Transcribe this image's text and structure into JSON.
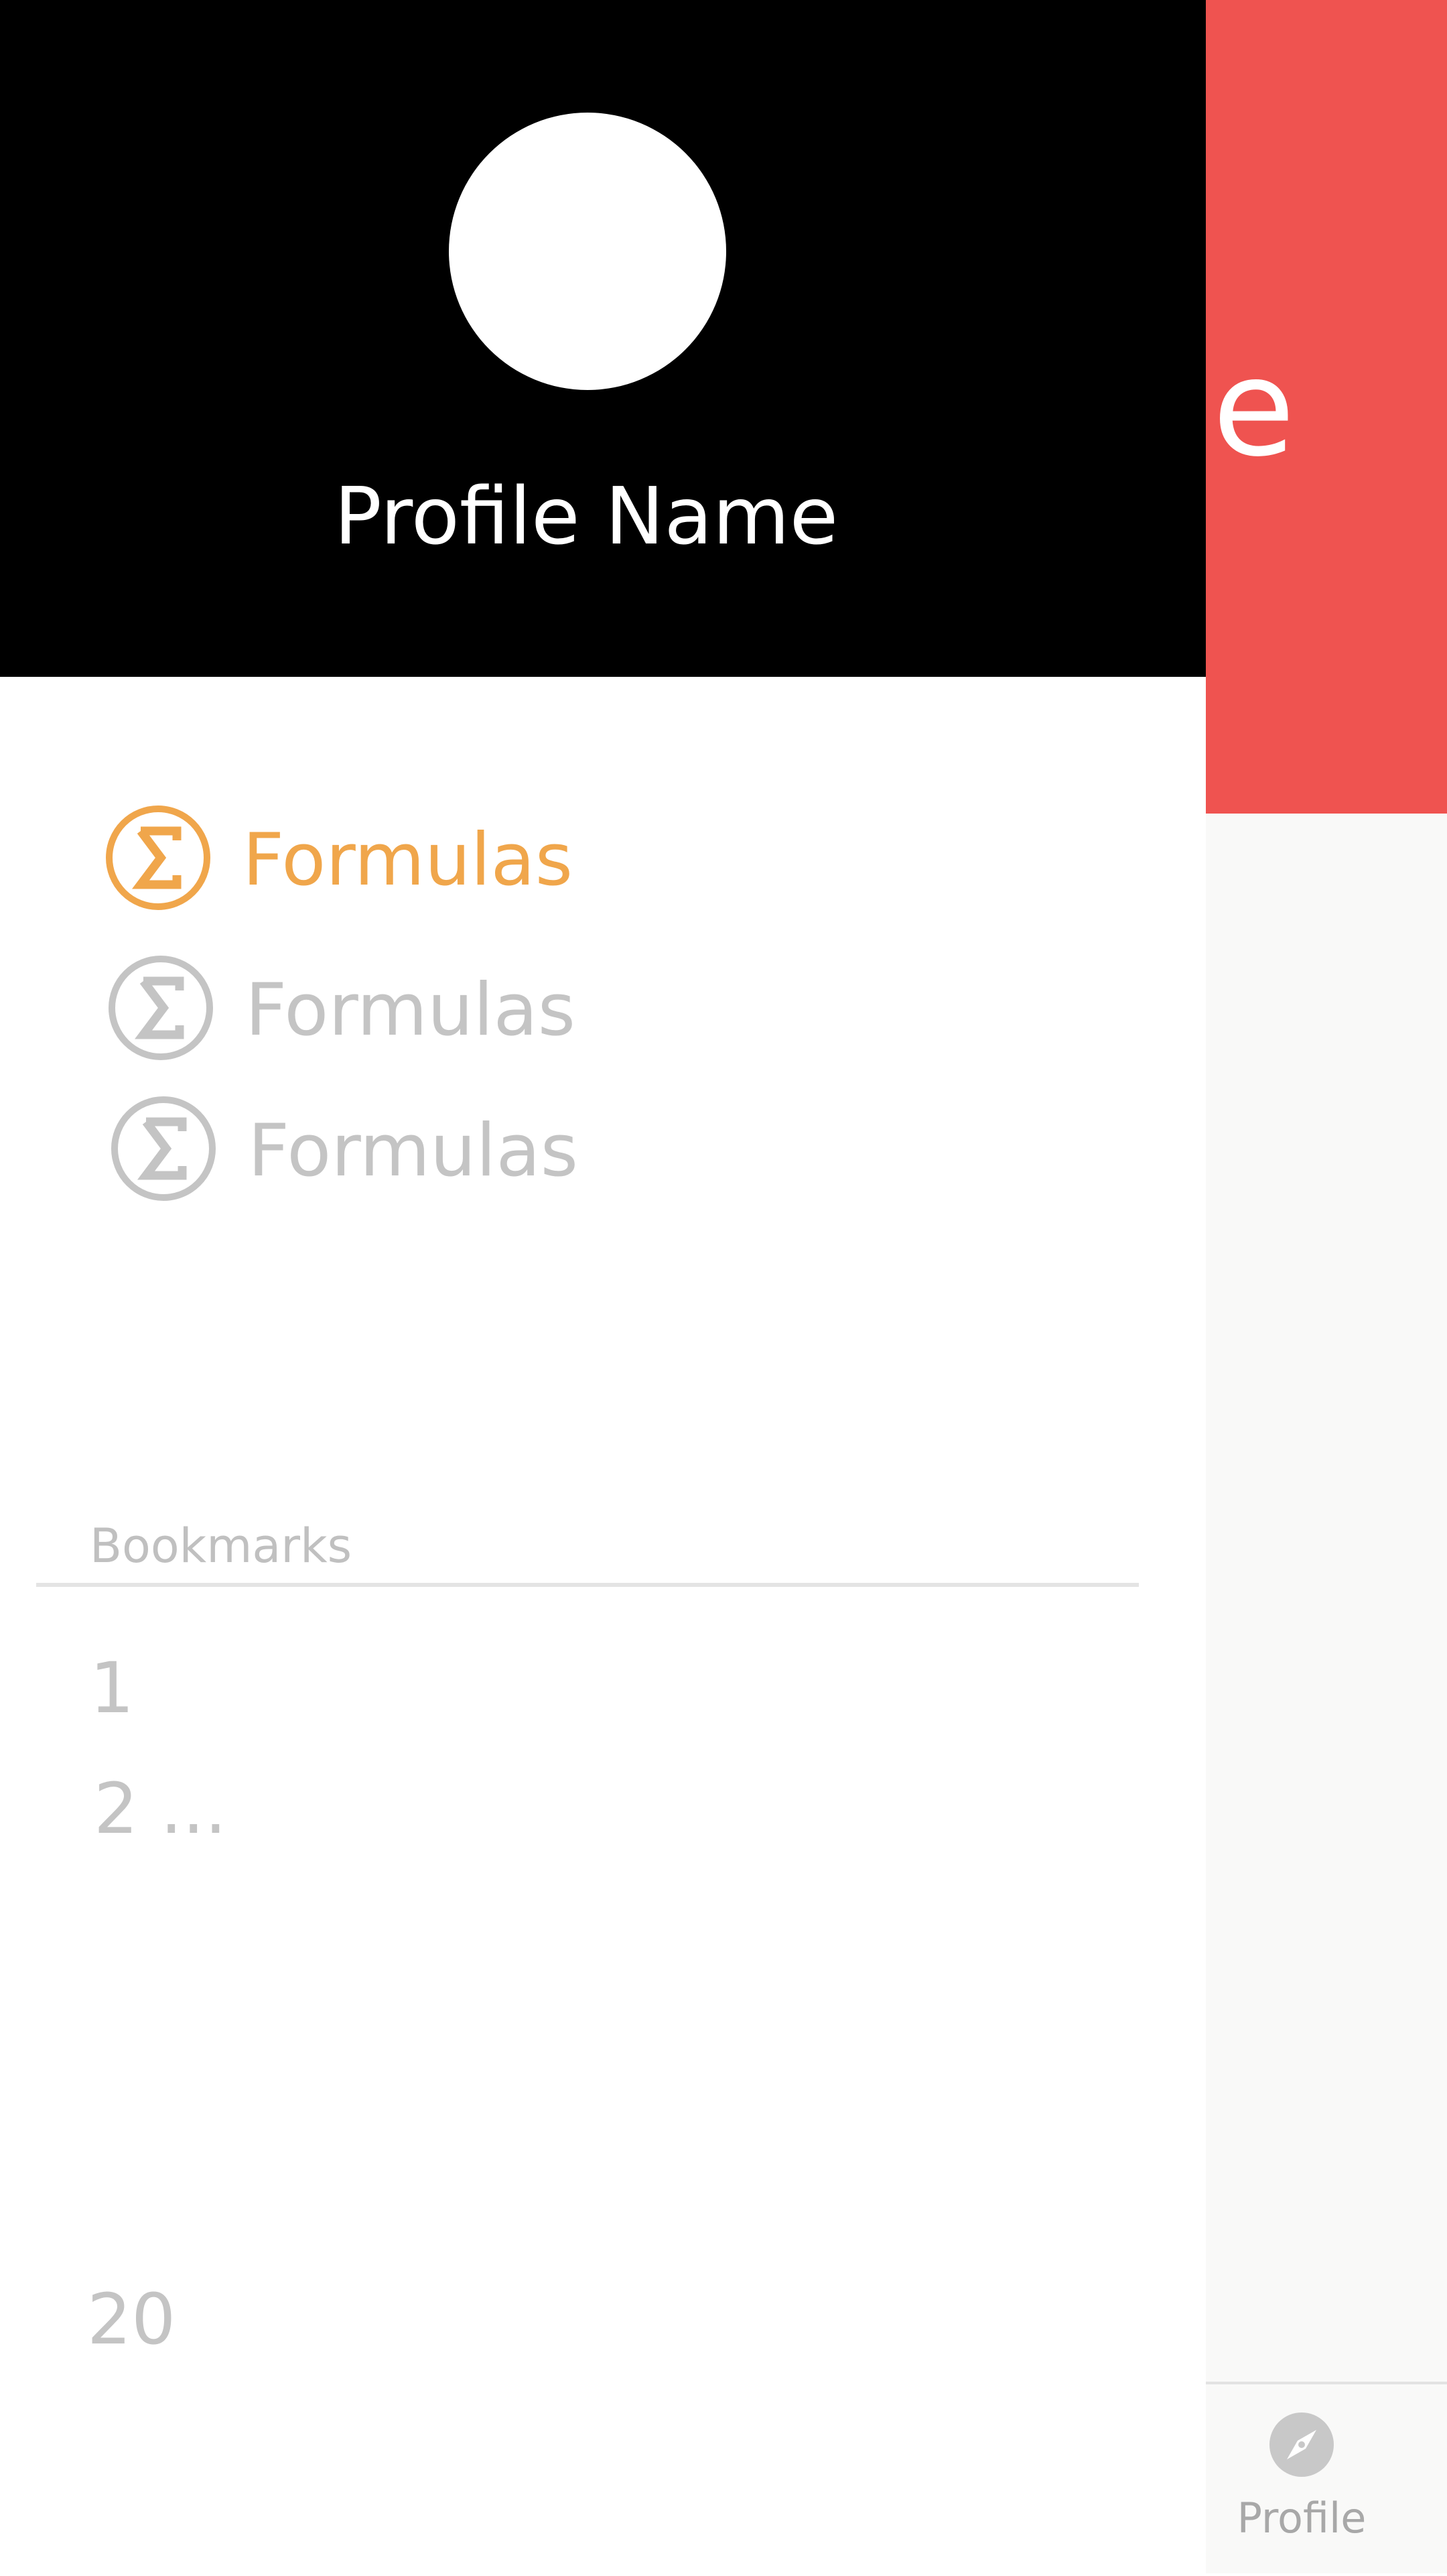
{
  "app": {
    "header_title_fragment": "e",
    "header_color": "#ef5350",
    "tabbar": {
      "items": [
        {
          "label": "Profile",
          "icon": "compass-icon"
        }
      ]
    }
  },
  "drawer": {
    "profile": {
      "name": "Profile Name",
      "avatar": "avatar-circle"
    },
    "menu": [
      {
        "label": "Formulas",
        "icon": "sigma-icon",
        "active": true,
        "color": "#f0a64b"
      },
      {
        "label": "Formulas",
        "icon": "sigma-icon",
        "active": false,
        "color": "#c4c4c4"
      },
      {
        "label": "Formulas",
        "icon": "sigma-icon",
        "active": false,
        "color": "#c4c4c4"
      }
    ],
    "bookmarks": {
      "title": "Bookmarks",
      "items": [
        "1",
        "2 ...",
        "20"
      ]
    }
  }
}
